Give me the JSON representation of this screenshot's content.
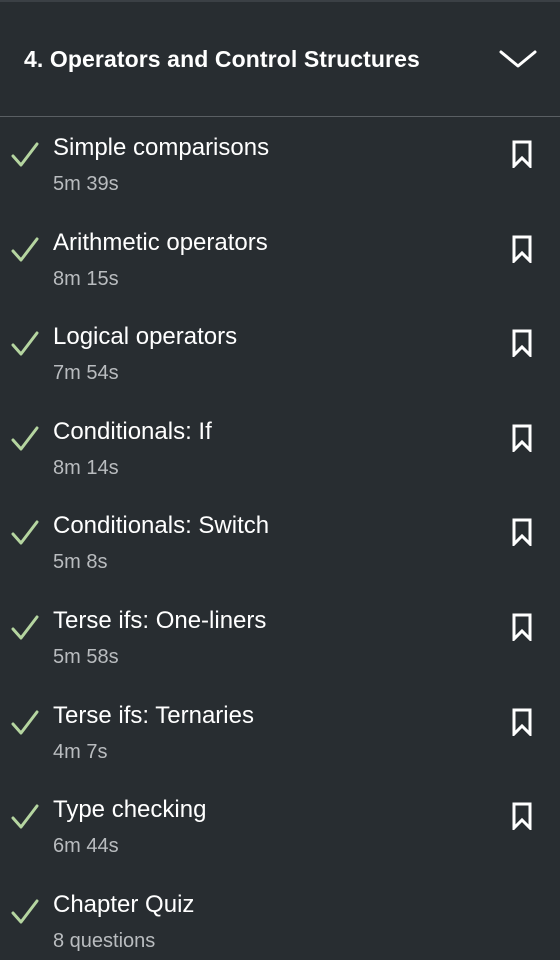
{
  "chapter": {
    "title": "4. Operators and Control Structures",
    "expanded": true
  },
  "lessons": [
    {
      "title": "Simple comparisons",
      "duration": "5m 39s",
      "completed": true,
      "bookmark": true
    },
    {
      "title": "Arithmetic operators",
      "duration": "8m 15s",
      "completed": true,
      "bookmark": true
    },
    {
      "title": "Logical operators",
      "duration": "7m 54s",
      "completed": true,
      "bookmark": true
    },
    {
      "title": "Conditionals: If",
      "duration": "8m 14s",
      "completed": true,
      "bookmark": true
    },
    {
      "title": "Conditionals: Switch",
      "duration": "5m 8s",
      "completed": true,
      "bookmark": true
    },
    {
      "title": "Terse ifs: One-liners",
      "duration": "5m 58s",
      "completed": true,
      "bookmark": true
    },
    {
      "title": "Terse ifs: Ternaries",
      "duration": "4m 7s",
      "completed": true,
      "bookmark": true
    },
    {
      "title": "Type checking",
      "duration": "6m 44s",
      "completed": true,
      "bookmark": true
    },
    {
      "title": "Chapter Quiz",
      "duration": "8 questions",
      "completed": true,
      "bookmark": false
    }
  ],
  "icons": {
    "check": "check-icon",
    "bookmark": "bookmark-icon",
    "chevron": "chevron-down-icon"
  },
  "colors": {
    "background": "#282d31",
    "check": "#b5d5a0",
    "title": "#ffffff",
    "subtitle": "#b9bcbf",
    "divider": "#5a5f63"
  }
}
